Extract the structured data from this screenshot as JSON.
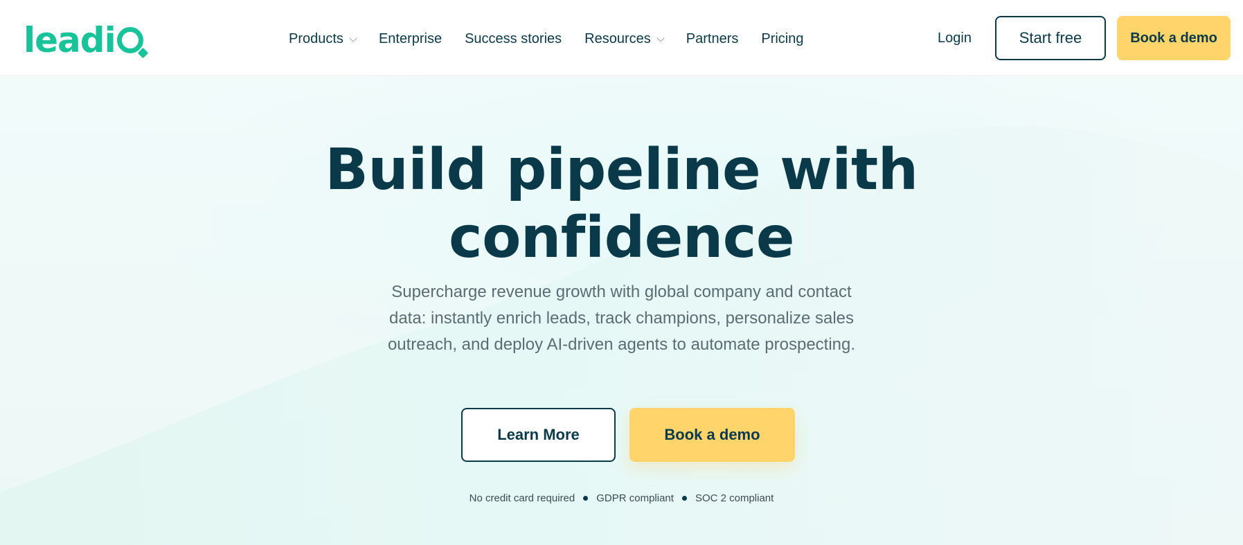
{
  "header": {
    "logo_text": "leadi",
    "nav": [
      {
        "label": "Products",
        "has_dropdown": true
      },
      {
        "label": "Enterprise",
        "has_dropdown": false
      },
      {
        "label": "Success stories",
        "has_dropdown": false
      },
      {
        "label": "Resources",
        "has_dropdown": true
      },
      {
        "label": "Partners",
        "has_dropdown": false
      },
      {
        "label": "Pricing",
        "has_dropdown": false
      }
    ],
    "login_label": "Login",
    "start_free_label": "Start free",
    "book_demo_label": "Book a demo"
  },
  "hero": {
    "title_line1": "Build pipeline with",
    "title_line2": "confidence",
    "subtitle": "Supercharge revenue growth with global company and contact data: instantly enrich leads, track champions, personalize sales outreach, and deploy AI-driven agents to automate prospecting.",
    "learn_more_label": "Learn More",
    "book_demo_label": "Book a demo",
    "badges": [
      "No credit card required",
      "GDPR compliant",
      "SOC 2 compliant"
    ]
  },
  "colors": {
    "brand_green": "#19c39a",
    "navy": "#0a3a4a",
    "cta_yellow": "#ffd46a",
    "muted_text": "#5b6d73"
  }
}
